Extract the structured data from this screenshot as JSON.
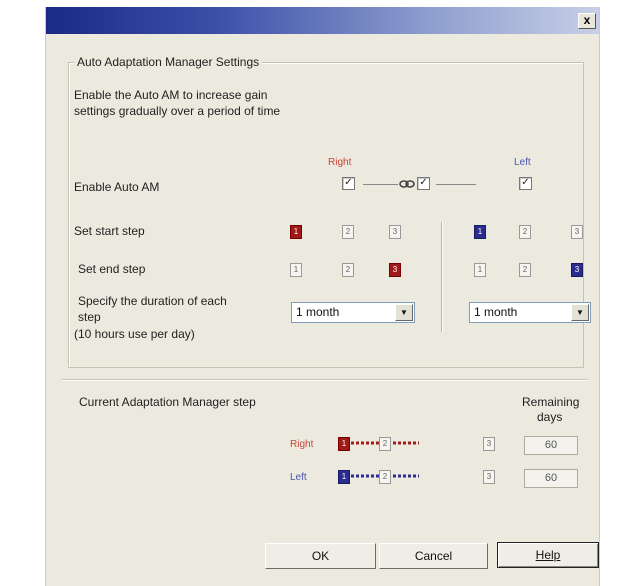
{
  "dialog": {
    "close_label": "x",
    "group_title": "Auto Adaptation Manager Settings",
    "description_line1": "Enable the Auto AM to increase gain",
    "description_line2": "settings gradually over a period of time",
    "side_right": "Right",
    "side_left": "Left",
    "enable_label": "Enable Auto AM",
    "start_label": "Set start step",
    "end_label": "Set end step",
    "duration_line1": "Specify the duration of each",
    "duration_line2": "step",
    "duration_line3": "(10 hours use per day)",
    "right_duration": "1 month",
    "left_duration": "1 month",
    "current_label": "Current Adaptation Manager step",
    "remaining_line1": "Remaining",
    "remaining_line2": "days",
    "right_remaining": "60",
    "left_remaining": "60",
    "steps": [
      "1",
      "2",
      "3"
    ],
    "ok_label": "OK",
    "cancel_label": "Cancel",
    "help_label": "Help"
  },
  "state": {
    "enable_right": true,
    "enable_left": true,
    "link_checked": true,
    "right_start_step": 1,
    "right_end_step": 3,
    "left_start_step": 1,
    "left_end_step": 3,
    "right_current_step": 1,
    "left_current_step": 1
  },
  "colors": {
    "right_accent": "#a11a1a",
    "left_accent": "#2b2b90"
  }
}
